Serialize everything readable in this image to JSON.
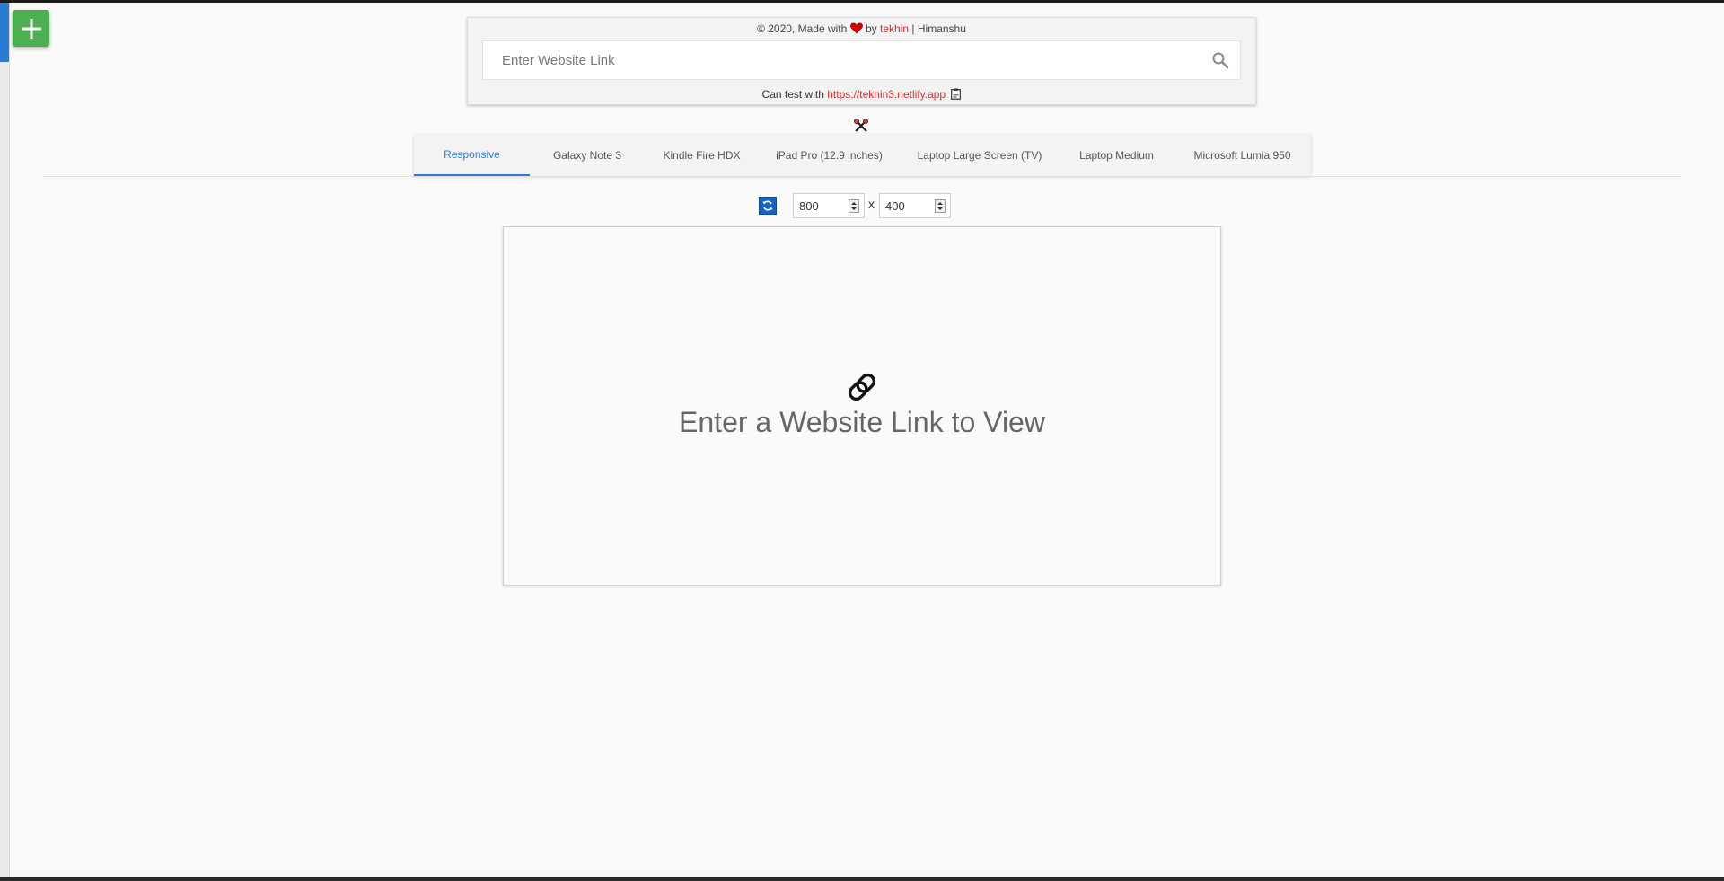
{
  "credits": {
    "prefix": "© 2020, Made with",
    "by": "by",
    "author_link": "tekhin",
    "separator": "|",
    "name": "Himanshu"
  },
  "search": {
    "placeholder": "Enter Website Link",
    "value": ""
  },
  "test_hint": {
    "prefix": "Can test with",
    "url": "https://tekhin3.netlify.app"
  },
  "tabs": [
    {
      "label": "Responsive",
      "active": true
    },
    {
      "label": "Galaxy Note 3",
      "active": false
    },
    {
      "label": "Kindle Fire HDX",
      "active": false
    },
    {
      "label": "iPad Pro (12.9 inches)",
      "active": false
    },
    {
      "label": "Laptop Large Screen (TV)",
      "active": false
    },
    {
      "label": "Laptop Medium",
      "active": false
    },
    {
      "label": "Microsoft Lumia 950",
      "active": false
    }
  ],
  "dimensions": {
    "width": "800",
    "height": "400",
    "separator": "x"
  },
  "viewport": {
    "placeholder": "Enter a Website Link to View"
  },
  "colors": {
    "accent": "#2a7bd4",
    "link": "#d32f2f",
    "fab": "#4caf50"
  }
}
